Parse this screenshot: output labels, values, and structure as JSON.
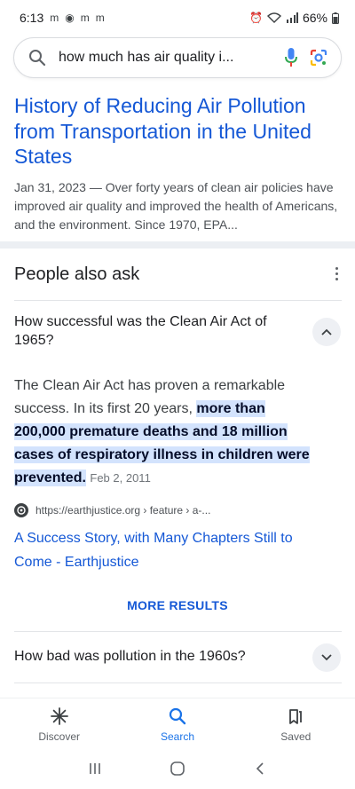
{
  "status_bar": {
    "time": "6:13",
    "battery": "66%"
  },
  "search": {
    "query": "how much has air quality i..."
  },
  "result": {
    "title": "History of Reducing Air Pollution from Transportation in the United States",
    "snippet": "Jan 31, 2023 — Over forty years of clean air policies have improved air quality and improved the health of Americans, and the environment. Since 1970, EPA..."
  },
  "people_also_ask": {
    "heading": "People also ask",
    "question_1": "How successful was the Clean Air Act of 1965?",
    "answer_plain": "The Clean Air Act has proven a remarkable success. In its first 20 years, ",
    "answer_highlight": "more than 200,000 premature deaths and 18 million cases of respiratory illness in children were prevented.",
    "answer_date": "Feb 2, 2011",
    "source_url": "https://earthjustice.org › feature › a-...",
    "source_title": "A Success Story, with Many Chapters Still to Come - Earthjustice",
    "more_results": "MORE RESULTS",
    "question_2": "How bad was pollution in the 1960s?"
  },
  "bottom_nav": {
    "discover": "Discover",
    "search": "Search",
    "saved": "Saved"
  },
  "colors": {
    "link": "#1558d6",
    "highlight": "#d3e3fd",
    "active_nav": "#1a73e8"
  }
}
